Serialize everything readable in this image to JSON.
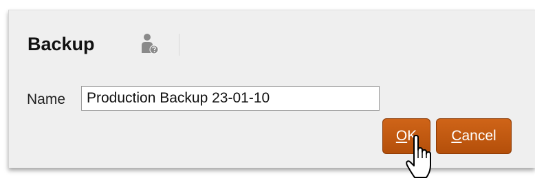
{
  "dialog": {
    "title": "Backup",
    "help_icon": "help-user-icon"
  },
  "form": {
    "name_label": "Name",
    "name_value": "Production Backup 23-01-10"
  },
  "buttons": {
    "ok": {
      "mnemonic": "O",
      "rest": "K"
    },
    "cancel": {
      "mnemonic": "C",
      "rest": "ancel"
    }
  },
  "colors": {
    "button_accent": "#c25a12",
    "dialog_background": "#efefef"
  },
  "cursor": "hand-pointer-icon"
}
